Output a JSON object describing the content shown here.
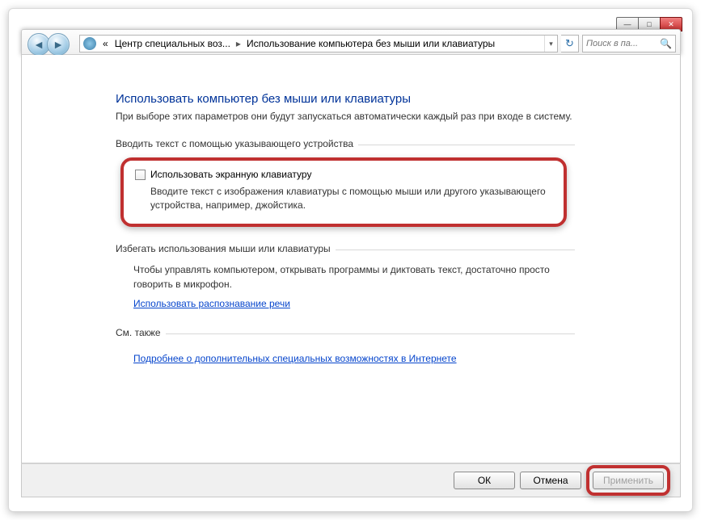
{
  "window": {
    "minimize": "—",
    "maximize": "□",
    "close": "✕"
  },
  "nav": {
    "back": "◄",
    "forward": "►",
    "refresh": "↻"
  },
  "breadcrumb": {
    "prefix": "«",
    "seg1": "Центр специальных воз...",
    "seg2": "Использование компьютера без мыши или клавиатуры"
  },
  "search": {
    "placeholder": "Поиск в па..."
  },
  "page": {
    "title": "Использовать компьютер без мыши или клавиатуры",
    "subtitle": "При выборе этих параметров они будут запускаться автоматически каждый раз при входе в систему."
  },
  "section1": {
    "label": "Вводить текст с помощью указывающего устройства",
    "checkbox_label": "Использовать экранную клавиатуру",
    "checkbox_desc": "Вводите текст с изображения клавиатуры с помощью мыши или другого указывающего устройства, например, джойстика."
  },
  "section2": {
    "label": "Избегать использования мыши или клавиатуры",
    "body": "Чтобы управлять компьютером, открывать программы и диктовать текст, достаточно просто говорить в микрофон.",
    "link": "Использовать распознавание речи"
  },
  "section3": {
    "label": "См. также",
    "link": "Подробнее о дополнительных специальных возможностях в Интернете"
  },
  "buttons": {
    "ok": "ОК",
    "cancel": "Отмена",
    "apply": "Применить"
  }
}
